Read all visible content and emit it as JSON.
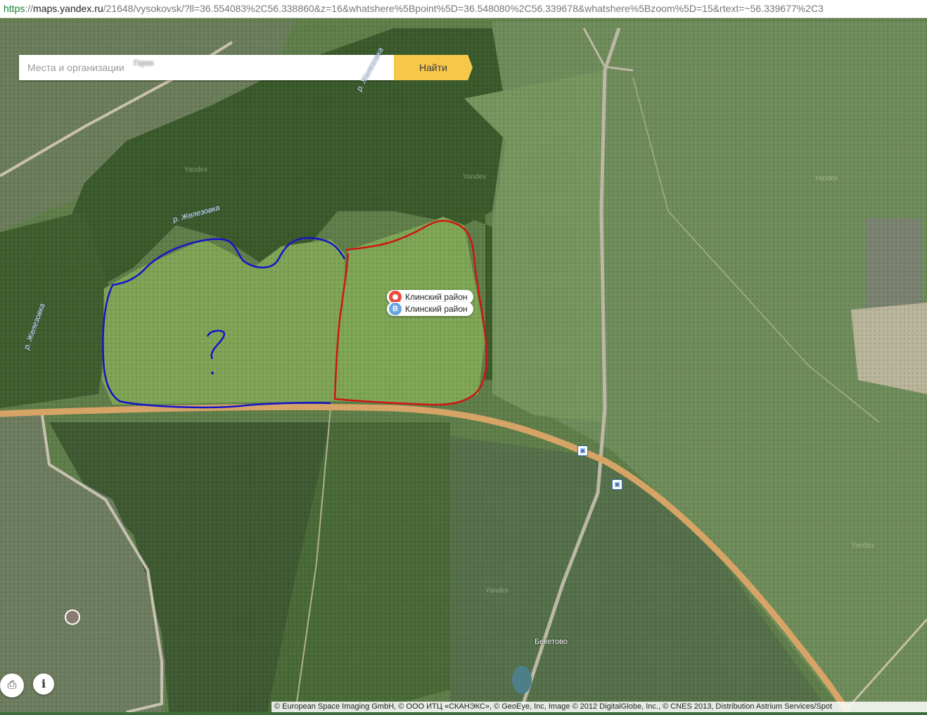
{
  "browser": {
    "url_scheme": "https",
    "url_sep": "://",
    "url_host": "maps.yandex.ru",
    "url_rest": "/21648/vysokovsk/?ll=36.554083%2C56.338860&z=16&whatshere%5Bpoint%5D=36.548080%2C56.339678&whatshere%5Bzoom%5D=15&rtext=~56.339677%2C3"
  },
  "search": {
    "placeholder": "Места и организации",
    "value": "",
    "button_label": "Найти"
  },
  "labels": {
    "river_top": "р. Железовка",
    "river_mid": "р. Железовка",
    "river_left": "р. Железовка",
    "village_top": "Горки",
    "village_bottom": "Бекетово"
  },
  "markers": {
    "marker_a_label": "Клинский район",
    "marker_b_label": "Клинский район",
    "marker_b_letter": "B"
  },
  "watermarks": [
    "Yandex",
    "Yandex",
    "Yandex",
    "Yandex",
    "Yandex"
  ],
  "annotations": {
    "question_mark": "?"
  },
  "icons": {
    "bus_stop": "bus-stop-icon",
    "print": "print-icon",
    "info": "info-icon"
  },
  "controls": {
    "print_glyph": "⎙",
    "info_glyph": "i"
  },
  "copyright": "© European Space Imaging GmbH, © ООО ИТЦ «СКАНЭКС», © GeoEye, Inc, Image © 2012 DigitalGlobe, Inc., © CNES 2013, Distribution Astrium Services/Spot",
  "colors": {
    "blue_outline": "#1414c8",
    "red_outline": "#d01414",
    "search_button": "#f7c74a",
    "road": "#d6a466"
  }
}
